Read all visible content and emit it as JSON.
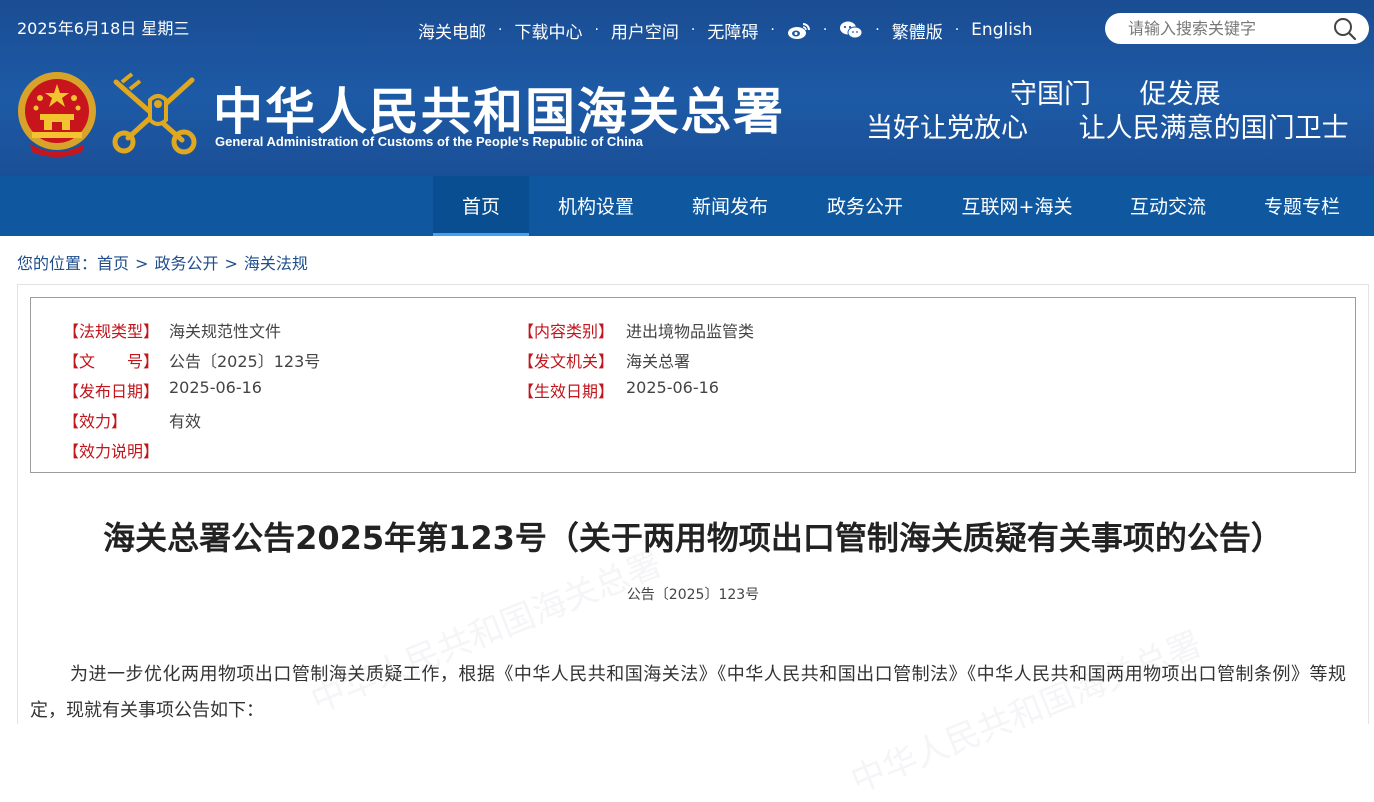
{
  "header": {
    "date": "2025年6月18日 星期三",
    "top_links": [
      "海关电邮",
      "下载中心",
      "用户空间",
      "无障碍"
    ],
    "lang_links": [
      "繁體版",
      "English"
    ],
    "separator": "·",
    "search_placeholder": "请输入搜索关键字",
    "title_cn": "中华人民共和国海关总署",
    "title_en": "General Administration of Customs of the People's Republic of China",
    "slogan_line1": [
      "守国门",
      "促发展"
    ],
    "slogan_line2": [
      "当好让党放心",
      "让人民满意的国门卫士"
    ],
    "colors": {
      "header_bg": "#1d5aa6",
      "nav_bg": "#0f58a0",
      "active_underline": "#41a3f0"
    }
  },
  "nav": {
    "items": [
      "首页",
      "机构设置",
      "新闻发布",
      "政务公开",
      "互联网+海关",
      "互动交流",
      "专题专栏"
    ],
    "active_index": 0
  },
  "breadcrumb": {
    "prefix": "您的位置：",
    "items": [
      "首页",
      "政务公开",
      "海关法规"
    ],
    "arrow": ">"
  },
  "meta": {
    "left": [
      {
        "label": "【法规类型】",
        "value": "海关规范性文件"
      },
      {
        "label": "【文　　号】",
        "value": "公告〔2025〕123号"
      },
      {
        "label": "【发布日期】",
        "value": "2025-06-16"
      },
      {
        "label": "【效力】",
        "value": "有效"
      },
      {
        "label": "【效力说明】",
        "value": ""
      }
    ],
    "right": [
      {
        "label": "【内容类别】",
        "value": "进出境物品监管类"
      },
      {
        "label": "【发文机关】",
        "value": "海关总署"
      },
      {
        "label": "【生效日期】",
        "value": "2025-06-16"
      }
    ],
    "label_color": "#c0161c"
  },
  "document": {
    "title": "海关总署公告2025年第123号（关于两用物项出口管制海关质疑有关事项的公告）",
    "number": "公告〔2025〕123号",
    "body": "为进一步优化两用物项出口管制海关质疑工作，根据《中华人民共和国海关法》《中华人民共和国出口管制法》《中华人民共和国两用物项出口管制条例》等规定，现就有关事项公告如下：",
    "watermark": "中华人民共和国海关总署"
  }
}
